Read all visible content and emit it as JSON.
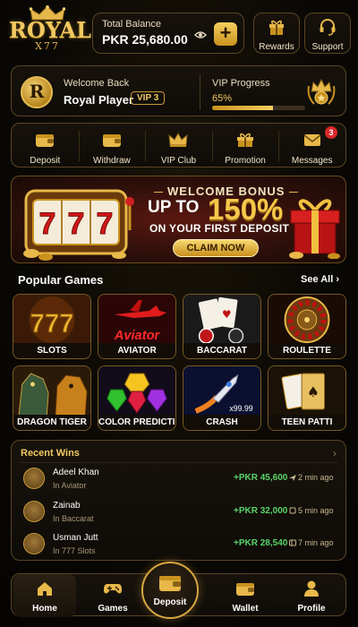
{
  "header": {
    "logo_brand": "ROYAL",
    "logo_sub": "X77",
    "balance_label": "Total Balance",
    "balance_amount": "PKR 25,680.00",
    "add_button": "+",
    "rewards_label": "Rewards",
    "support_label": "Support"
  },
  "welcome": {
    "avatar_letter": "R",
    "greeting": "Welcome Back",
    "name": "Royal Player",
    "vip_badge": "VIP 3",
    "vip_progress_label": "VIP Progress",
    "vip_progress_text": "65%",
    "vip_progress_value": 0.65
  },
  "actions": [
    {
      "label": "Deposit",
      "icon": "wallet-icon"
    },
    {
      "label": "Withdraw",
      "icon": "wallet-out-icon"
    },
    {
      "label": "VIP Club",
      "icon": "crown-icon"
    },
    {
      "label": "Promotion",
      "icon": "gift-icon"
    },
    {
      "label": "Messages",
      "icon": "mail-icon",
      "badge": "3"
    }
  ],
  "banner": {
    "kicker": "WELCOME BONUS",
    "line1": "UP TO",
    "percent": "150%",
    "line2": "ON YOUR FIRST DEPOSIT",
    "cta": "CLAIM NOW",
    "slot_digits": "777"
  },
  "popular": {
    "title": "Popular Games",
    "see_all": "See All",
    "games": [
      {
        "label": "SLOTS",
        "art_text": "777"
      },
      {
        "label": "AVIATOR",
        "art_text": "Aviator"
      },
      {
        "label": "BACCARAT",
        "art_text": ""
      },
      {
        "label": "ROULETTE",
        "art_text": ""
      },
      {
        "label": "DRAGON TIGER",
        "art_text": ""
      },
      {
        "label": "COLOR PREDICTION",
        "art_text": ""
      },
      {
        "label": "CRASH",
        "art_text": "x99.99"
      },
      {
        "label": "TEEN PATTI",
        "art_text": ""
      }
    ]
  },
  "recent_wins": {
    "title": "Recent Wins",
    "rows": [
      {
        "name": "Adeel Khan",
        "game": "In Aviator",
        "amount": "+PKR 45,600",
        "time": "2 min ago"
      },
      {
        "name": "Zainab",
        "game": "In Baccarat",
        "amount": "+PKR 32,000",
        "time": "5 min ago"
      },
      {
        "name": "Usman Jutt",
        "game": "In 777 Slots",
        "amount": "+PKR 28,540",
        "time": "7 min ago"
      }
    ]
  },
  "nav": {
    "home": "Home",
    "games": "Games",
    "deposit": "Deposit",
    "wallet": "Wallet",
    "profile": "Profile"
  },
  "colors": {
    "gold": "#e8b84a",
    "background": "#0a0805",
    "win_green": "#5ad468",
    "badge_red": "#d8282a"
  }
}
